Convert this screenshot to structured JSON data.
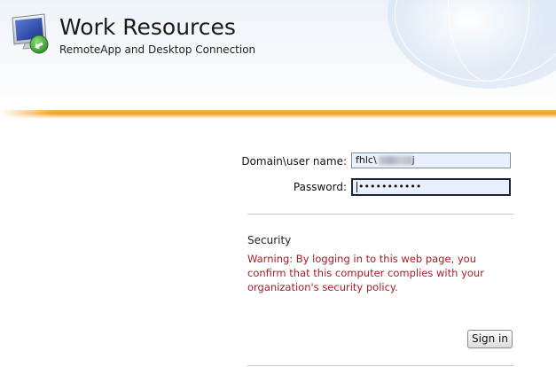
{
  "header": {
    "title": "Work Resources",
    "subtitle": "RemoteApp and Desktop Connection",
    "logo_icon": "remote-desktop-monitor-icon"
  },
  "login": {
    "username_label": "Domain\\user name:",
    "username_value": "fhlc\\",
    "username_tail": "j",
    "password_label": "Password:",
    "password_value": "•••••••••••",
    "signin_label": "Sign in"
  },
  "security": {
    "title": "Security",
    "warning": "Warning: By logging in to this web page, you confirm that this computer complies with your organization's security policy."
  },
  "colors": {
    "accent_orange": "#f29b1f",
    "warning_red": "#a51f24",
    "input_bg": "#e8f0fb"
  }
}
